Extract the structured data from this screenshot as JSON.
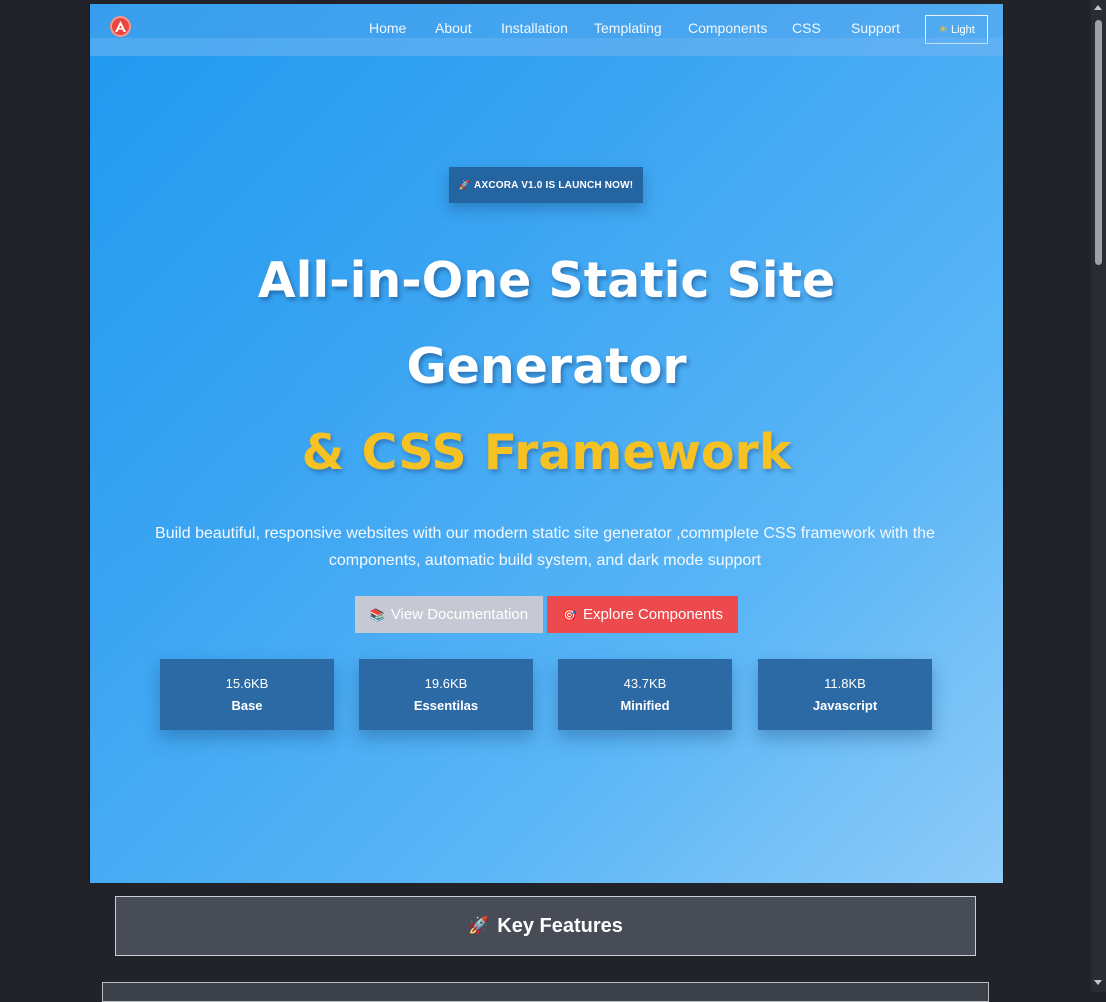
{
  "nav": {
    "logo_icon": "axcora-logo-icon",
    "links": [
      "Home",
      "About",
      "Installation",
      "Templating",
      "Components",
      "CSS",
      "Support"
    ],
    "theme_toggle": {
      "icon": "sun-icon",
      "label": "Light"
    }
  },
  "hero": {
    "badge": {
      "icon": "rocket-icon",
      "label": "AXCORA V1.0 IS LAUNCH NOW!"
    },
    "title_line1": "All-in-One Static Site",
    "title_line2": "Generator",
    "title_accent": "& CSS Framework",
    "description": "Build beautiful, responsive websites with our modern static site generator ,commplete CSS framework with the components, automatic build system, and dark mode support",
    "buttons": [
      {
        "icon": "books-icon",
        "label": "View Documentation"
      },
      {
        "icon": "target-icon",
        "label": "Explore Components"
      }
    ],
    "stats": [
      {
        "value": "15.6KB",
        "label": "Base"
      },
      {
        "value": "19.6KB",
        "label": "Essentilas"
      },
      {
        "value": "43.7KB",
        "label": "Minified"
      },
      {
        "value": "11.8KB",
        "label": "Javascript"
      }
    ]
  },
  "features": {
    "icon": "rocket-icon",
    "title": "Key Features"
  },
  "colors": {
    "accent_yellow": "#f6c122",
    "explore_button": "#ec4a4d",
    "docs_button": "#c6c9d3",
    "stat_card": "#2b6aa5",
    "badge": "#2464a0",
    "page_background": "#212328"
  }
}
